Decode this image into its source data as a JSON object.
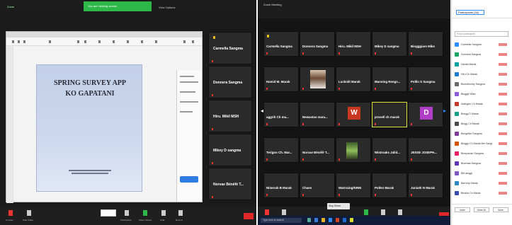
{
  "left_window": {
    "title": "Zoom",
    "sharing_banner": "You are viewing screen",
    "menu_label": "View Options",
    "slide": {
      "title_line1": "SPRING SURVEY APP",
      "title_line2": "KO GAPATANI"
    },
    "participants": [
      {
        "name": "Carmella Sangma"
      },
      {
        "name": "Donnera Sangma"
      },
      {
        "name": "Hiru. Mikil MSH"
      },
      {
        "name": "Mikey D sangma"
      },
      {
        "name": "Norvae Bénéfé T..."
      }
    ],
    "bottom_controls": [
      "Unmute",
      "Start Video",
      "Participants",
      "Share Screen",
      "Chat",
      "Record",
      "Reactions"
    ],
    "end_label": "End"
  },
  "right_window": {
    "title": "Zoom Meeting",
    "tiles": [
      {
        "name": "Carmella Sangma"
      },
      {
        "name": "Donnera Sangma"
      },
      {
        "name": "Hiru. Mikil MSH"
      },
      {
        "name": "Mikey D sangma"
      },
      {
        "name": "Bingggiare Mike"
      },
      {
        "name": "Hamid M. Marak"
      },
      {
        "name": "",
        "avatar": "photo"
      },
      {
        "name": "Lucknilt Marak"
      },
      {
        "name": "Manning Rengs..."
      },
      {
        "name": "Pollin S Sangma"
      },
      {
        "name": "aggrih Ch ma..."
      },
      {
        "name": "Newastas mara..."
      },
      {
        "name": "",
        "avatar": "W",
        "avatar_color": "#c8371f"
      },
      {
        "name": "prosell ch marak",
        "active": true
      },
      {
        "name": "",
        "avatar": "D",
        "avatar_color": "#b03ec9"
      },
      {
        "name": "Terigno Ch. Mar..."
      },
      {
        "name": "Norvae Bénéfé T..."
      },
      {
        "name": "",
        "avatar": "plant"
      },
      {
        "name": "Wistroaks Jalid..."
      },
      {
        "name": "JESSE JOSEPH..."
      },
      {
        "name": "Nimerah B Marak"
      },
      {
        "name": "Chaes"
      },
      {
        "name": "Watrraing/NINN"
      },
      {
        "name": "Pollen Marak"
      },
      {
        "name": "Juniath N Marak"
      }
    ],
    "tooltip": "Stop Share",
    "taskbar_search": "Type here to search"
  },
  "participants_panel": {
    "header_button": "Participants (30)",
    "search_placeholder": "Find a participant",
    "rows": [
      {
        "name": "Carmella Sangma",
        "color": "#2d8cff"
      },
      {
        "name": "Donnera Sangma",
        "color": "#18a463"
      },
      {
        "name": "Hamid Marak",
        "color": "#0aa0a0"
      },
      {
        "name": "Hiru Ch Marak",
        "color": "#1e7fcf"
      },
      {
        "name": "Bunnehmilly Sangma",
        "color": "#6a6a6a"
      },
      {
        "name": "Binggie Mike",
        "color": "#8c5cd8"
      },
      {
        "name": "Adavgen Ch Marak",
        "color": "#c0392b"
      },
      {
        "name": "Bringg D Marak",
        "color": "#16a085"
      },
      {
        "name": "Bingg Ch Marak",
        "color": "#4a4a4a"
      },
      {
        "name": "Bengettin Sangma",
        "color": "#7d3c98"
      },
      {
        "name": "Binggy Ch Marak Ber Sangma",
        "color": "#d35400"
      },
      {
        "name": "Bheyranah Sangma",
        "color": "#e91e63"
      },
      {
        "name": "Bherbaa Sangma",
        "color": "#5e35b1"
      },
      {
        "name": "Bilt tanggi",
        "color": "#7e57c2"
      },
      {
        "name": "Barrnny Marak",
        "color": "#2e86c1"
      },
      {
        "name": "Binaka Ch Marak",
        "color": "#3949ab"
      }
    ],
    "footer_buttons": [
      "Invite",
      "Mute All",
      "More"
    ]
  }
}
